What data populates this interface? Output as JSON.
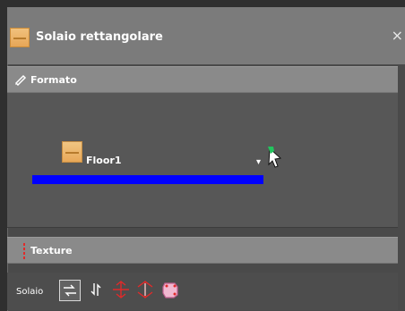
{
  "title": "Solaio rettangolare",
  "close": "×",
  "formato": {
    "label": "Formato"
  },
  "floor": {
    "name": "Floor1",
    "dropdown": "▾"
  },
  "texture": {
    "label": "Texture"
  },
  "toolbar": {
    "label": "Solaio"
  },
  "colors": {
    "bar": "#0000ff",
    "accent": "#e12a2a",
    "header": "#8a8a8a"
  },
  "icons": {
    "title": "floor-icon",
    "formato": "brush-icon",
    "texture": "red-dots-icon",
    "cursor": "pointer-icon",
    "toolbar": [
      "direction-horizontal-icon",
      "direction-vertical-icon",
      "red-arrow-icon",
      "red-arrow-alt-icon",
      "pink-shape-icon"
    ]
  }
}
